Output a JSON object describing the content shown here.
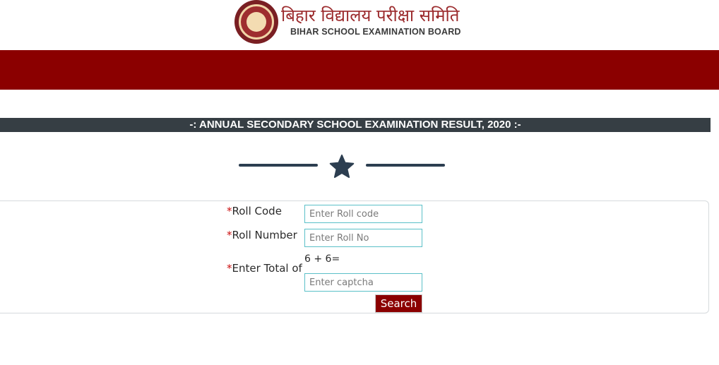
{
  "header": {
    "logo_hindi": "बिहार विद्यालय परीक्षा समिति",
    "logo_english": "BIHAR SCHOOL EXAMINATION BOARD"
  },
  "title_bar": {
    "text": "-: ANNUAL SECONDARY SCHOOL EXAMINATION RESULT, 2020 :-"
  },
  "form": {
    "required_marker": "*",
    "roll_code": {
      "label": "Roll Code",
      "placeholder": "Enter Roll code",
      "value": ""
    },
    "roll_number": {
      "label": "Roll Number",
      "placeholder": "Enter Roll No",
      "value": ""
    },
    "captcha": {
      "label": "Enter Total of",
      "question": "6 + 6=",
      "placeholder": "Enter captcha",
      "value": ""
    },
    "search_label": "Search"
  },
  "colors": {
    "brand_red": "#8b0000",
    "title_bar_bg": "#363e44",
    "divider": "#2c3e50",
    "input_border": "#5bc0c8",
    "required": "#cc1111"
  },
  "icons": {
    "logo": "bseb-seal-logo",
    "divider": "star-icon"
  }
}
